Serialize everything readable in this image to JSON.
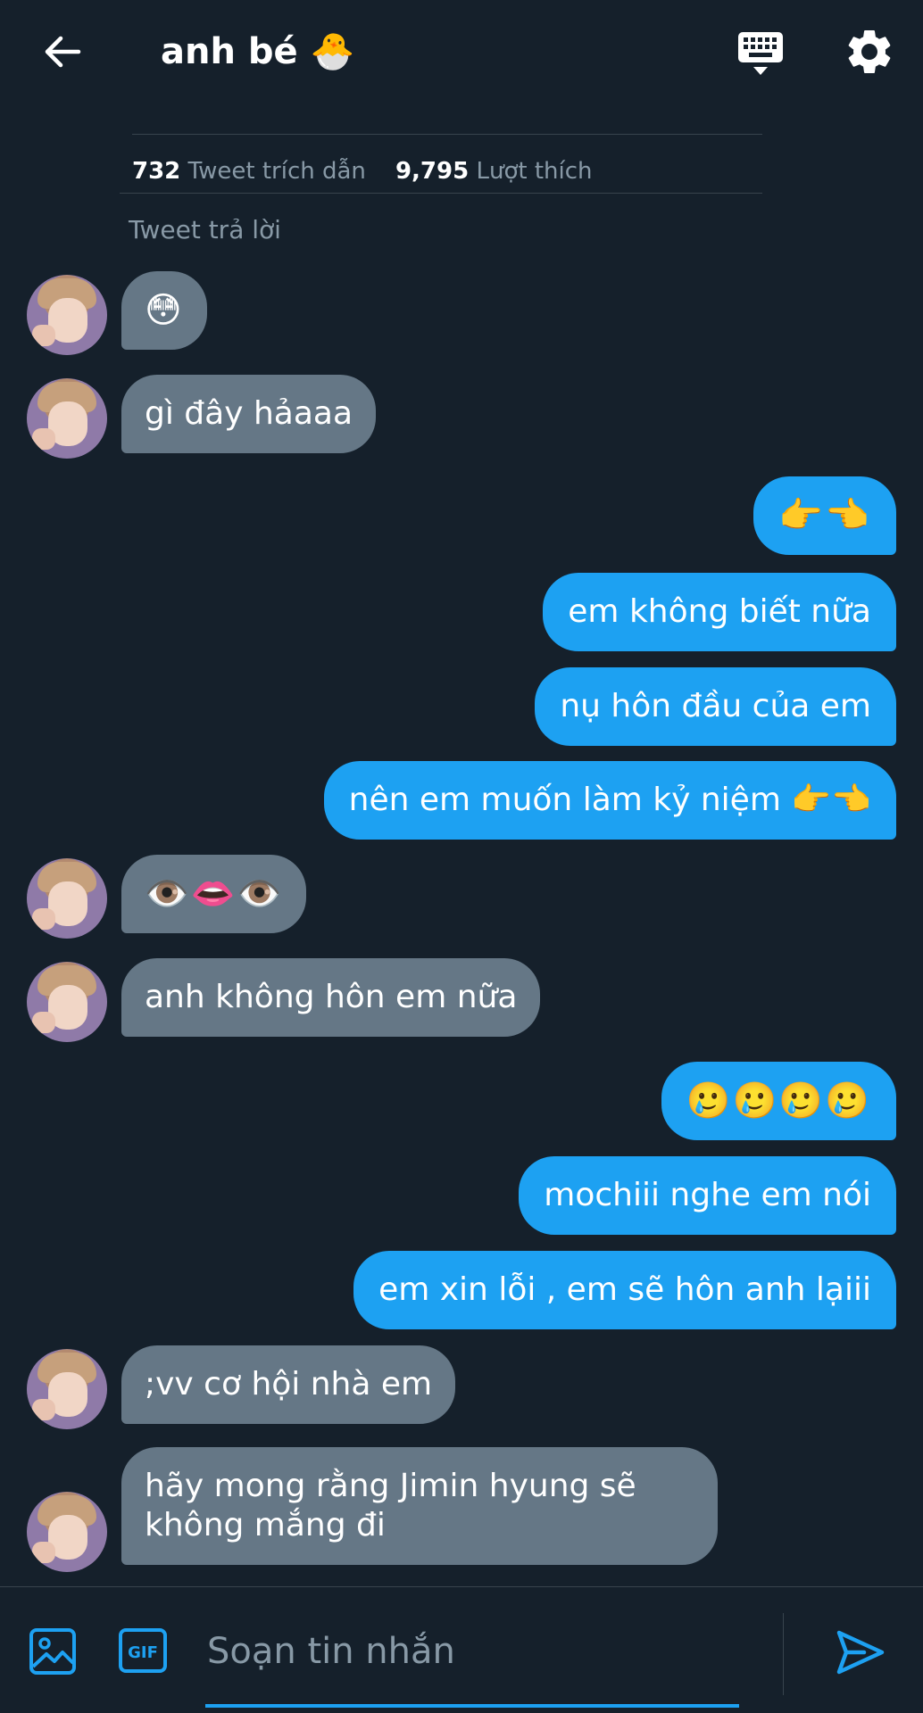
{
  "header": {
    "title": "anh bé",
    "title_emoji": "🐣"
  },
  "stats": {
    "quote_count": "732",
    "quote_label": "Tweet trích dẫn",
    "like_count": "9,795",
    "like_label": "Lượt thích"
  },
  "reply_label": "Tweet trả lời",
  "messages": [
    {
      "from": "them",
      "text": "😳"
    },
    {
      "from": "them",
      "text": "gì đây hảaaa"
    },
    {
      "from": "me",
      "text": "👉👈"
    },
    {
      "from": "me",
      "text": "em không biết nữa"
    },
    {
      "from": "me",
      "text": "nụ hôn đầu của em"
    },
    {
      "from": "me",
      "text": "nên em muốn làm kỷ niệm 👉👈"
    },
    {
      "from": "them",
      "text": "👁️👄👁️"
    },
    {
      "from": "them",
      "text": "anh không hôn em nữa"
    },
    {
      "from": "me",
      "text": "🥲🥲🥲🥲"
    },
    {
      "from": "me",
      "text": "mochiii nghe em nói"
    },
    {
      "from": "me",
      "text": "em xin lỗi , em sẽ hôn anh lạiii"
    },
    {
      "from": "them",
      "text": ";vv cơ hội nhà em"
    },
    {
      "from": "them",
      "text": "hãy mong rằng Jimin hyung sẽ không mắng đi"
    }
  ],
  "compose": {
    "placeholder": "Soạn tin nhắn",
    "gif_label": "GIF"
  },
  "icons": {
    "back": "arrow-left-icon",
    "keyboard": "keyboard-icon",
    "settings": "gear-icon",
    "image": "image-icon",
    "gif": "gif-icon",
    "send": "send-icon"
  },
  "colors": {
    "background": "#15202b",
    "sent_bubble": "#1da1f2",
    "received_bubble": "#657786",
    "muted_text": "#8899a6",
    "divider": "#38444d"
  }
}
